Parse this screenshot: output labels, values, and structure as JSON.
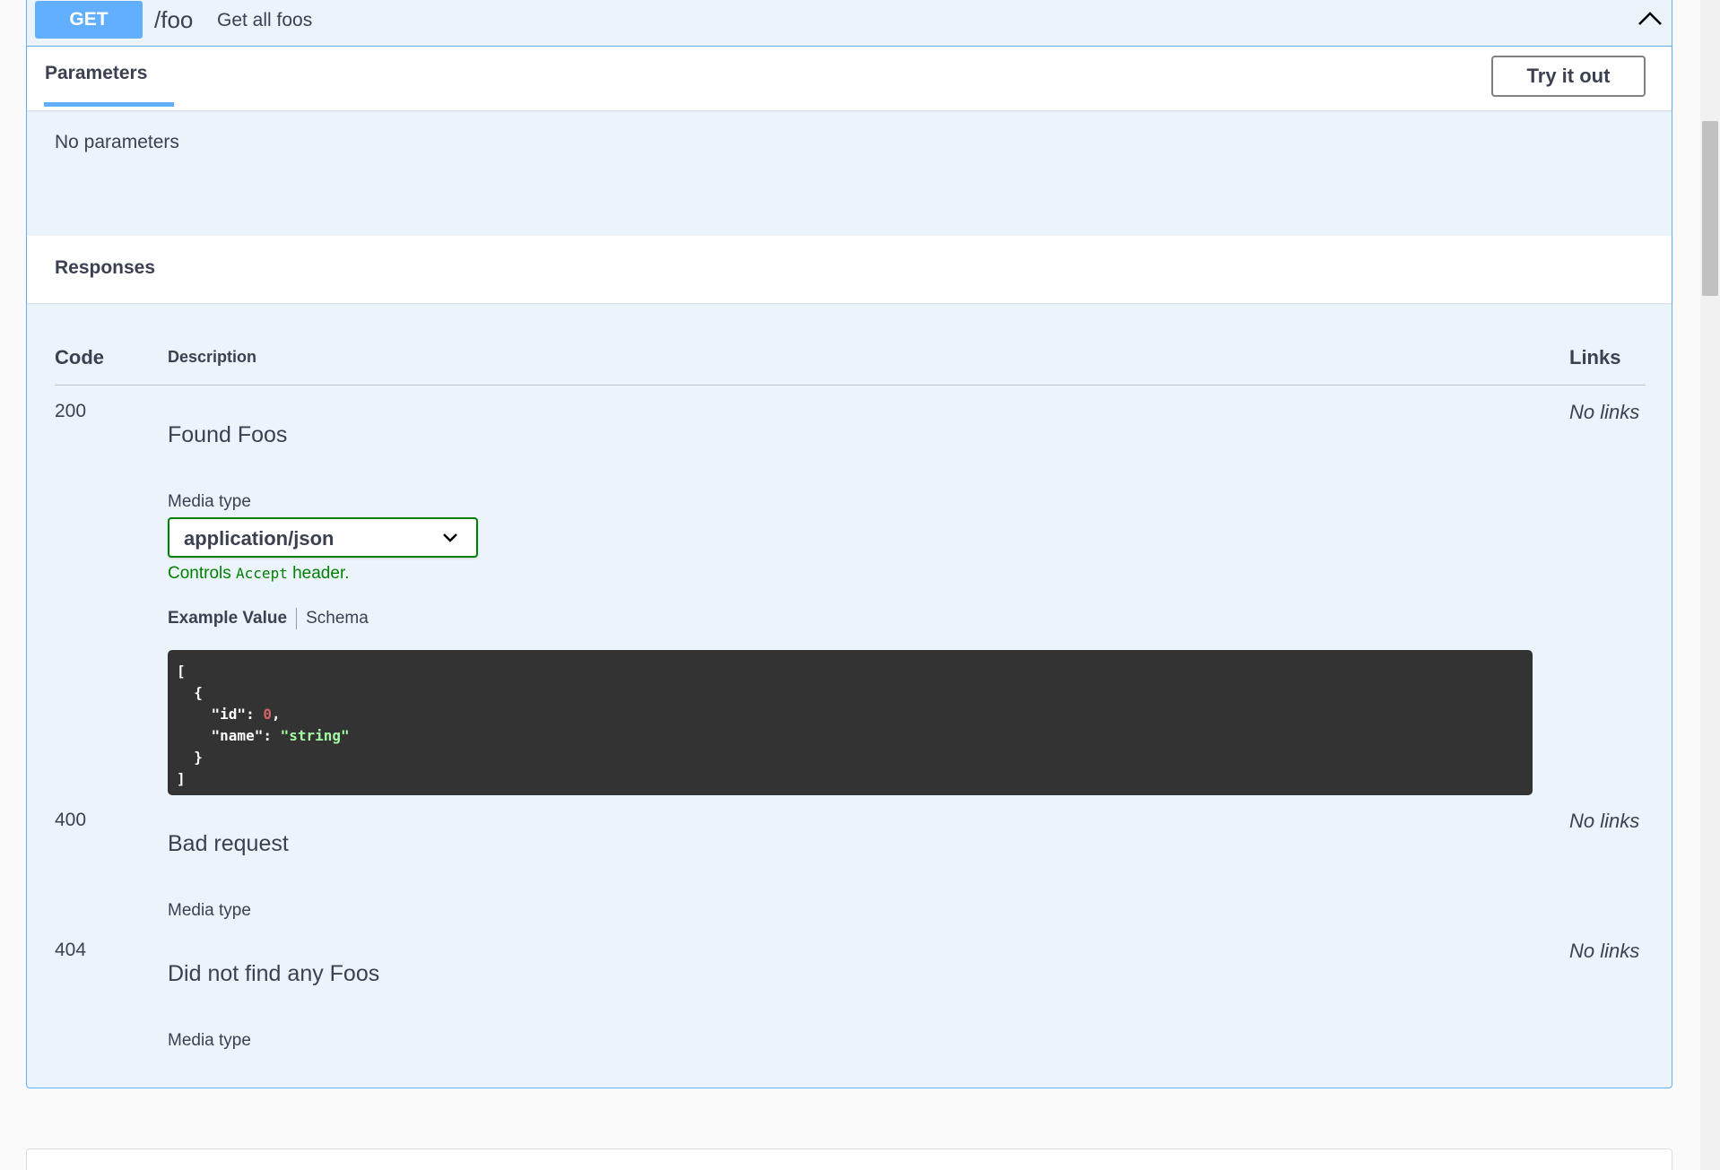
{
  "operation": {
    "method": "GET",
    "path": "/foo",
    "summary": "Get all foos"
  },
  "parameters": {
    "tab_label": "Parameters",
    "try_button": "Try it out",
    "empty_text": "No parameters"
  },
  "responses": {
    "title": "Responses",
    "headers": {
      "code": "Code",
      "description": "Description",
      "links": "Links"
    },
    "items": [
      {
        "code": "200",
        "description": "Found Foos",
        "links": "No links",
        "media_label": "Media type"
      },
      {
        "code": "400",
        "description": "Bad request",
        "links": "No links",
        "media_label": "Media type"
      },
      {
        "code": "404",
        "description": "Did not find any Foos",
        "links": "No links",
        "media_label": "Media type"
      }
    ],
    "media_select": {
      "value": "application/json"
    },
    "controls_note": {
      "prefix": "Controls ",
      "code": "Accept",
      "suffix": " header."
    },
    "example_tabs": {
      "example": "Example Value",
      "schema": "Schema"
    },
    "example_json": {
      "open_bracket": "[",
      "open_brace": "{",
      "id_key": "\"id\"",
      "id_value": "0",
      "name_key": "\"name\"",
      "name_value": "\"string\"",
      "close_brace": "}",
      "close_bracket": "]"
    }
  },
  "colors": {
    "get_method": "#61affe",
    "opblock_bg": "#ebf3fb",
    "success_green": "#008000",
    "code_bg": "#333333"
  }
}
